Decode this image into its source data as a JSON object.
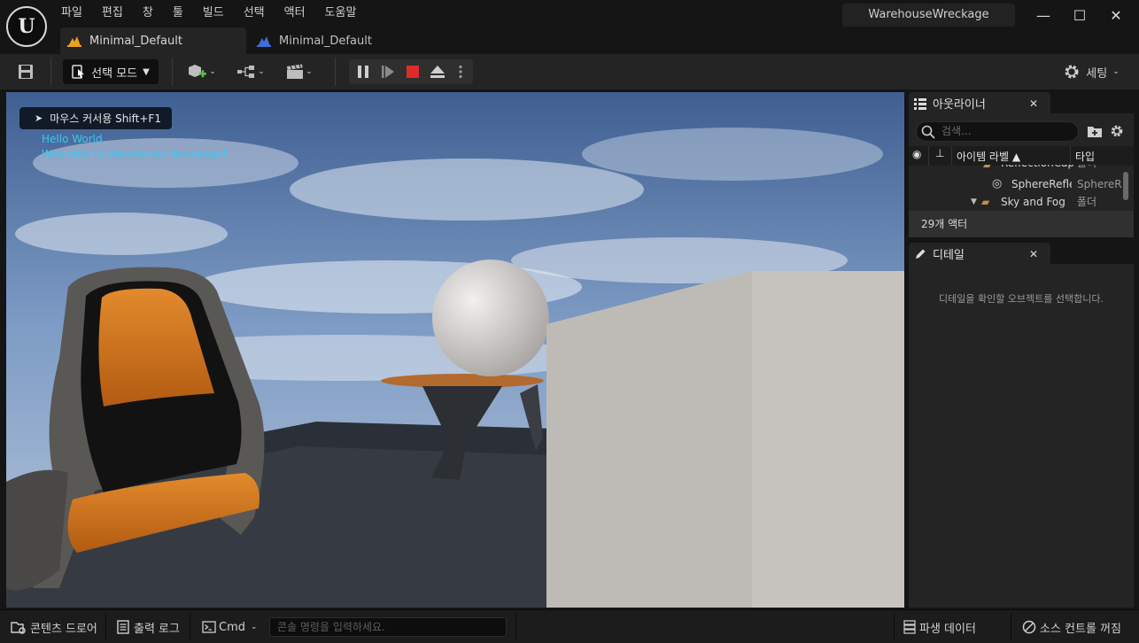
{
  "menu": [
    "파일",
    "편집",
    "창",
    "툴",
    "빌드",
    "선택",
    "액터",
    "도움말"
  ],
  "project_name": "WarehouseWreckage",
  "window_controls": {
    "minimize": "—",
    "maximize": "☐",
    "close": "✕"
  },
  "tabs": [
    {
      "label": "Minimal_Default",
      "icon": "level-icon",
      "active": true
    },
    {
      "label": "Minimal_Default",
      "icon": "blueprint-level-icon",
      "active": false
    }
  ],
  "toolbar": {
    "mode_label": "선택 모드",
    "settings_label": "세팅"
  },
  "viewport": {
    "hud_hint": "마우스 커서용 Shift+F1",
    "messages": [
      "Hello World",
      "Welcome to Warehouse Wreckage!"
    ]
  },
  "outliner": {
    "tab_label": "아웃라이너",
    "search_placeholder": "검색...",
    "columns": {
      "label": "아이템 라벨 ▲",
      "type": "타입"
    },
    "rows": [
      {
        "name": "ReflectionCap",
        "type": "폴더"
      },
      {
        "name": "SphereRefle",
        "type": "SphereR"
      },
      {
        "name": "Sky and Fog",
        "type": "폴더"
      }
    ],
    "actor_count": "29개 액터"
  },
  "details": {
    "tab_label": "디테일",
    "empty_message": "디테일을 확인할 오브젝트를 선택합니다."
  },
  "statusbar": {
    "content_drawer": "콘텐츠 드로어",
    "output_log": "출력 로그",
    "cmd_label": "Cmd",
    "cmd_placeholder": "콘솔 명령을 입력하세요.",
    "derived_data": "파생 데이터",
    "source_control": "소스 컨트롤 꺼짐"
  },
  "colors": {
    "accent_orange": "#e8a11f",
    "stop_red": "#e02b2b",
    "hud_cyan": "#38c8f0"
  }
}
